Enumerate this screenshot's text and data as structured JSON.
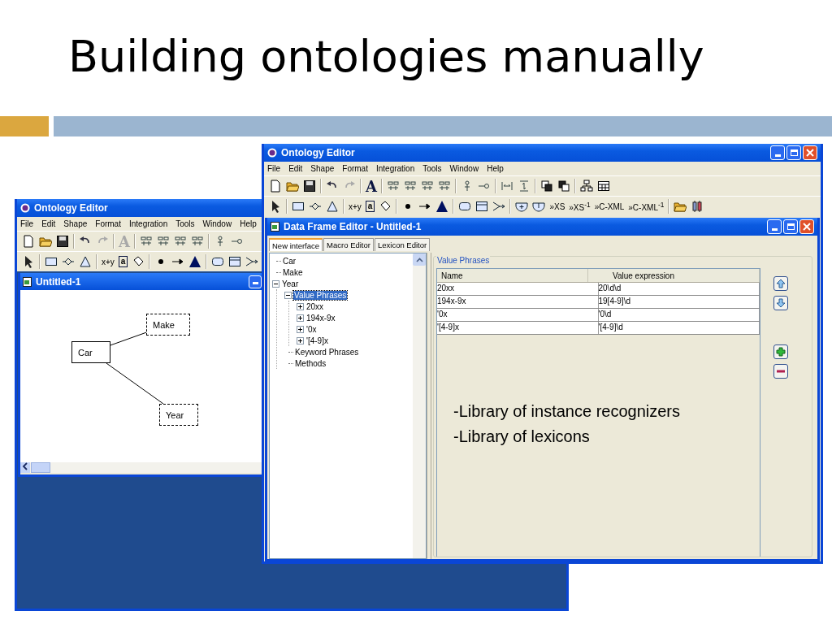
{
  "slide": {
    "title": "Building ontologies manually",
    "notes": [
      "-Library of instance recognizers",
      "-Library of lexicons"
    ]
  },
  "back_window": {
    "title": "Ontology Editor",
    "menu": [
      "File",
      "Edit",
      "Shape",
      "Format",
      "Integration",
      "Tools",
      "Window",
      "Help"
    ],
    "toolbar_1": [
      {
        "label": "A",
        "kind": "glyph",
        "disabled": true
      }
    ],
    "toolbar_2": [
      {
        "label": "x+y",
        "kind": "plain"
      },
      {
        "label": "a",
        "kind": "boxed"
      }
    ],
    "document": {
      "title": "Untitled-1",
      "nodes": [
        {
          "label": "Car",
          "kind": "nonlexical"
        },
        {
          "label": "Make",
          "kind": "lexical"
        },
        {
          "label": "Year",
          "kind": "lexical"
        }
      ]
    }
  },
  "front_window": {
    "title": "Ontology Editor",
    "menu": [
      "File",
      "Edit",
      "Shape",
      "Format",
      "Integration",
      "Tools",
      "Window",
      "Help"
    ],
    "toolbar_1": [
      {
        "label": "A",
        "kind": "glyph",
        "disabled": false
      }
    ],
    "toolbar_2": [
      {
        "label": "x+y",
        "kind": "plain"
      },
      {
        "label": "a",
        "kind": "boxed"
      },
      {
        "label": "»XS",
        "kind": "plain"
      },
      {
        "label": "»XS$^{-1}$",
        "kind": "plain"
      },
      {
        "label": "»C-XML",
        "kind": "plain"
      },
      {
        "label": "»C-XML$^{-1}$",
        "kind": "plain"
      }
    ],
    "editor": {
      "title": "Data Frame Editor - Untitled-1",
      "tabs": [
        {
          "label": "New interface",
          "selected": true
        },
        {
          "label": "Macro Editor",
          "selected": false
        },
        {
          "label": "Lexicon Editor",
          "selected": false
        }
      ],
      "tree": [
        {
          "label": "Car",
          "selected": false
        },
        {
          "label": "Make",
          "selected": false
        },
        {
          "label": "Year",
          "selected": false,
          "expanded": true,
          "children": [
            {
              "label": "Value Phrases",
              "selected": true,
              "expanded": true,
              "children": [
                {
                  "label": "20xx",
                  "selected": false,
                  "expanded": false
                },
                {
                  "label": "194x-9x",
                  "selected": false,
                  "expanded": false
                },
                {
                  "label": "'0x",
                  "selected": false,
                  "expanded": false
                },
                {
                  "label": "'[4-9]x",
                  "selected": false,
                  "expanded": false
                }
              ]
            },
            {
              "label": "Keyword Phrases",
              "selected": false
            },
            {
              "label": "Methods",
              "selected": false
            }
          ]
        }
      ],
      "group_title": "Value Phrases",
      "table": {
        "columns": [
          "Name",
          "Value expression"
        ],
        "rows": [
          [
            "20xx",
            "20\\d\\d"
          ],
          [
            "194x-9x",
            "19[4-9]\\d"
          ],
          [
            "'0x",
            "'0\\d"
          ],
          [
            "'[4-9]x",
            "'[4-9]\\d"
          ]
        ]
      }
    }
  }
}
